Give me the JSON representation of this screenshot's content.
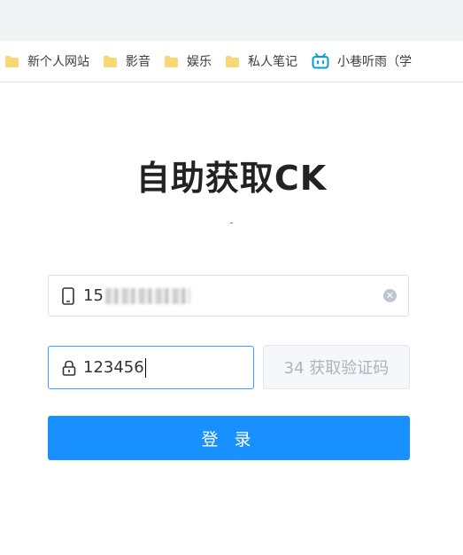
{
  "bookmarks": {
    "items": [
      {
        "label": "新个人网站",
        "icon": "folder-icon"
      },
      {
        "label": "影音",
        "icon": "folder-icon"
      },
      {
        "label": "娱乐",
        "icon": "folder-icon"
      },
      {
        "label": "私人笔记",
        "icon": "folder-icon"
      },
      {
        "label": "小巷听雨（学",
        "icon": "bilibili-icon"
      }
    ]
  },
  "page": {
    "title": "自助获取CK",
    "subtitle": "-"
  },
  "form": {
    "phone": {
      "value": "15",
      "icon": "phone-icon"
    },
    "code": {
      "value": "123456",
      "icon": "lock-icon"
    },
    "sms_button": "34 获取验证码",
    "login_button": "登 录"
  },
  "colors": {
    "primary": "#1890ff",
    "focus_border": "#409eff",
    "folder": "#f8d775"
  }
}
